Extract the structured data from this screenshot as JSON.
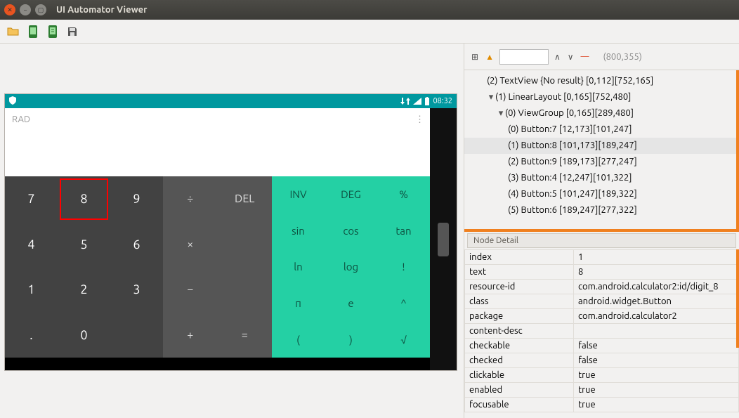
{
  "window": {
    "title": "UI Automator Viewer"
  },
  "device": {
    "status": {
      "time": "08:32"
    },
    "mode": "RAD",
    "digits": [
      "7",
      "8",
      "9",
      "4",
      "5",
      "6",
      "1",
      "2",
      "3",
      ".",
      "0",
      ""
    ],
    "ops": [
      "÷",
      "DEL",
      "×",
      "",
      "−",
      "",
      "+",
      "="
    ],
    "adv": [
      "INV",
      "DEG",
      "%",
      "sin",
      "cos",
      "tan",
      "ln",
      "log",
      "!",
      "π",
      "e",
      "^",
      "(",
      ")",
      "√"
    ],
    "highlight_index": 1
  },
  "treetop": {
    "coord": "(800,355)"
  },
  "tree": [
    {
      "depth": 1,
      "label": "(2) TextView {No result} [0,112][752,165]"
    },
    {
      "depth": 1,
      "label": "(1) LinearLayout [0,165][752,480]",
      "caret": "▾"
    },
    {
      "depth": 2,
      "label": "(0) ViewGroup [0,165][289,480]",
      "caret": "▾"
    },
    {
      "depth": 3,
      "label": "(0) Button:7 [12,173][101,247]"
    },
    {
      "depth": 3,
      "label": "(1) Button:8 [101,173][189,247]",
      "selected": true
    },
    {
      "depth": 3,
      "label": "(2) Button:9 [189,173][277,247]"
    },
    {
      "depth": 3,
      "label": "(3) Button:4 [12,247][101,322]"
    },
    {
      "depth": 3,
      "label": "(4) Button:5 [101,247][189,322]"
    },
    {
      "depth": 3,
      "label": "(5) Button:6 [189,247][277,322]"
    }
  ],
  "detail_header": "Node Detail",
  "detail": [
    {
      "k": "index",
      "v": "1"
    },
    {
      "k": "text",
      "v": "8"
    },
    {
      "k": "resource-id",
      "v": "com.android.calculator2:id/digit_8"
    },
    {
      "k": "class",
      "v": "android.widget.Button"
    },
    {
      "k": "package",
      "v": "com.android.calculator2"
    },
    {
      "k": "content-desc",
      "v": ""
    },
    {
      "k": "checkable",
      "v": "false"
    },
    {
      "k": "checked",
      "v": "false"
    },
    {
      "k": "clickable",
      "v": "true"
    },
    {
      "k": "enabled",
      "v": "true"
    },
    {
      "k": "focusable",
      "v": "true"
    }
  ]
}
